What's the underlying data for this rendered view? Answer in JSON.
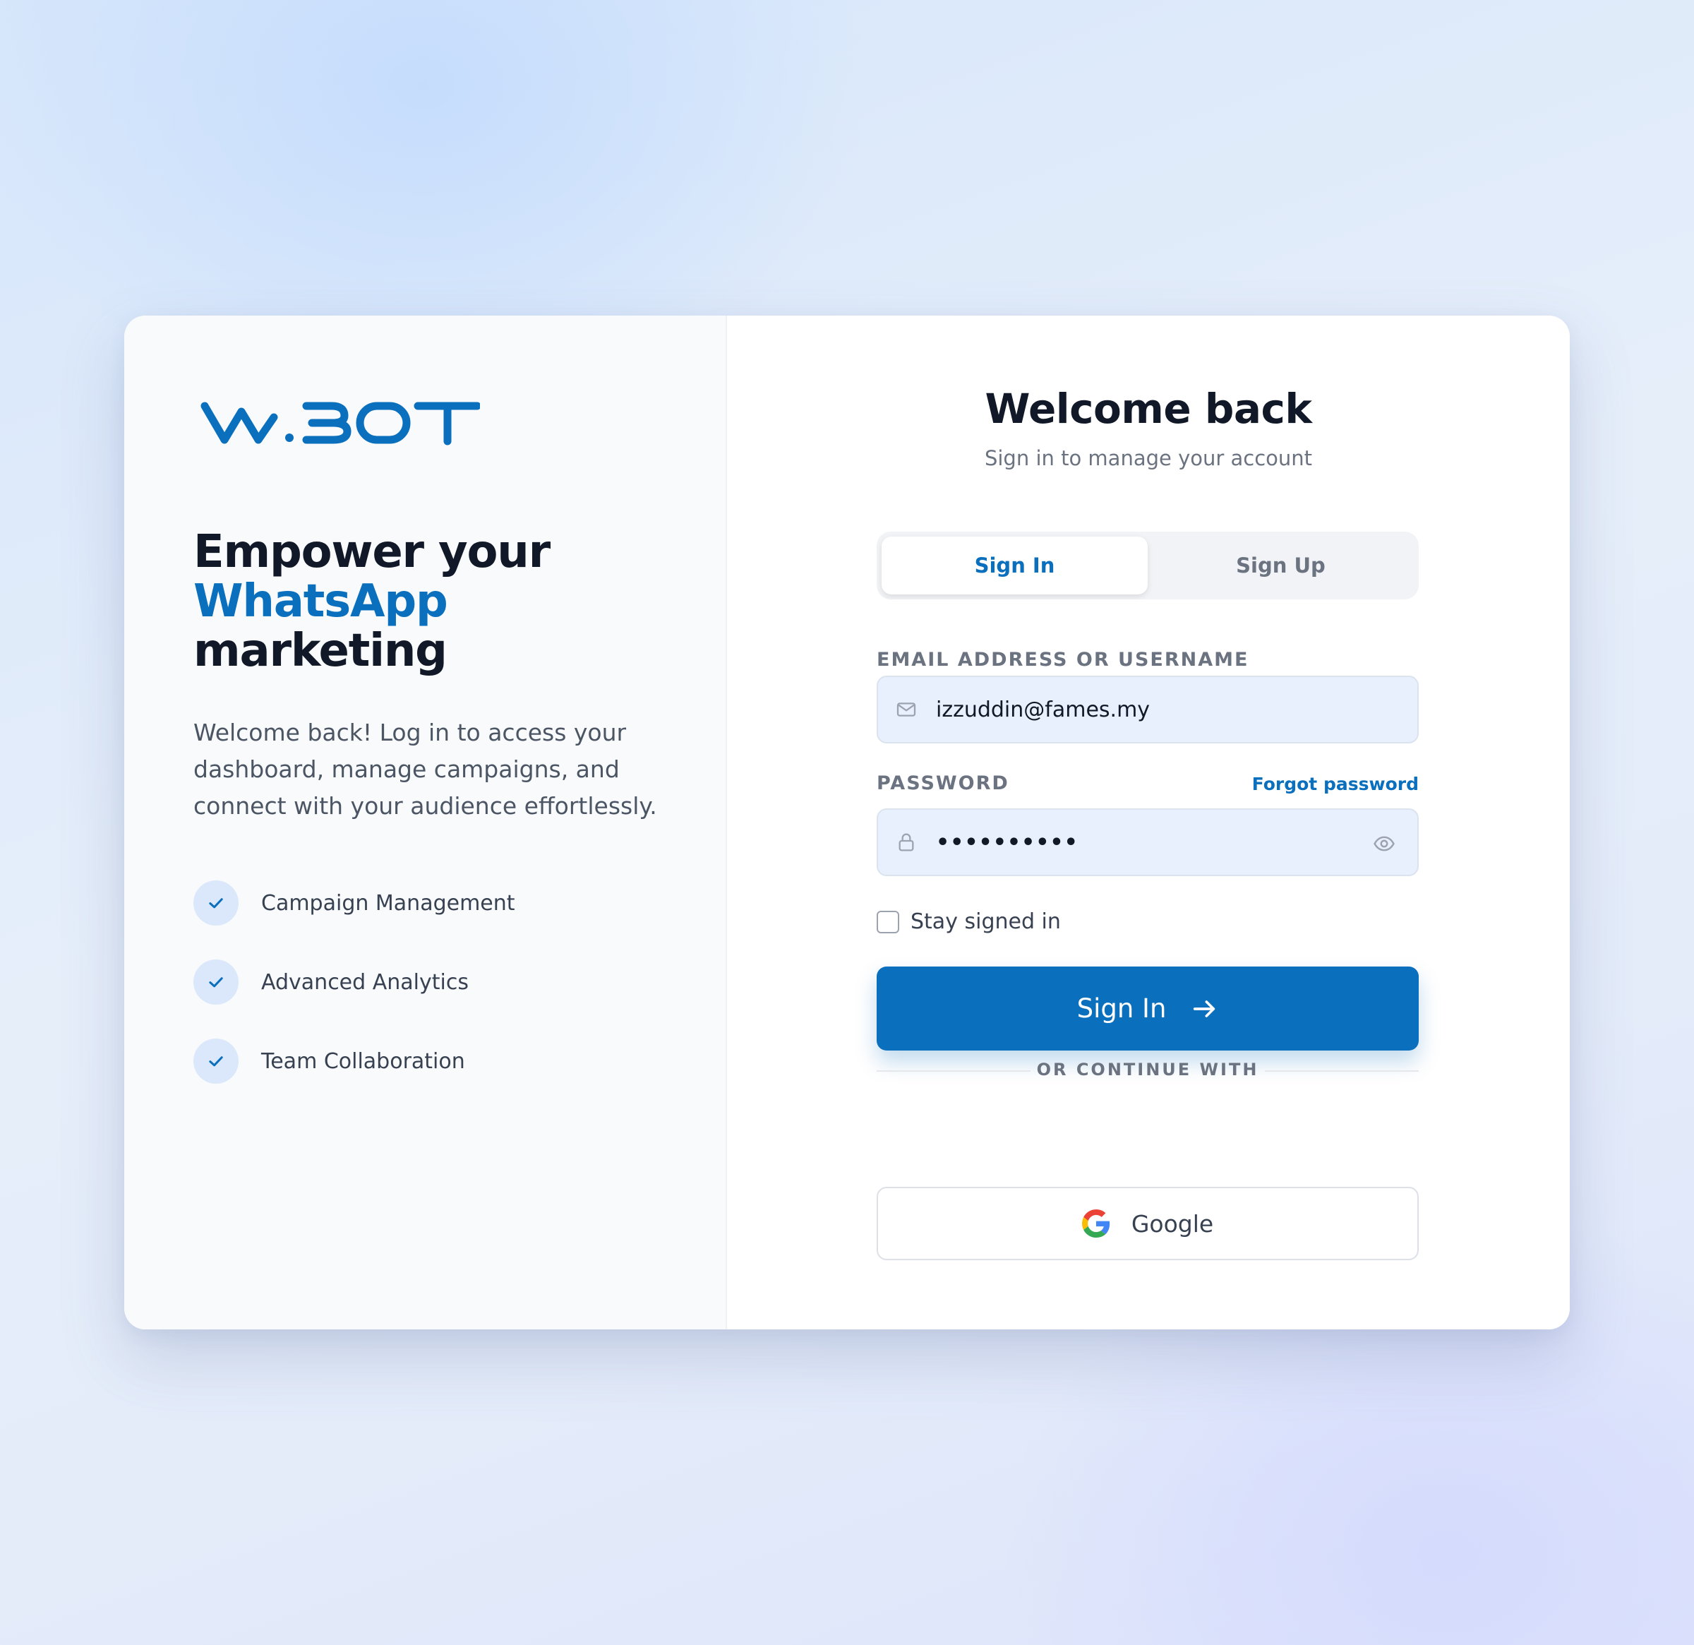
{
  "brand": {
    "logo_text": "WABOT",
    "accent_color": "#0a6fbd"
  },
  "hero": {
    "headline_line1": "Empower your",
    "headline_line2": "WhatsApp",
    "headline_line3": "marketing",
    "description": "Welcome back! Log in to access your dashboard, manage campaigns, and connect with your audience effortlessly.",
    "features": [
      {
        "icon": "check-icon",
        "label": "Campaign Management"
      },
      {
        "icon": "check-icon",
        "label": "Advanced Analytics"
      },
      {
        "icon": "check-icon",
        "label": "Team Collaboration"
      }
    ]
  },
  "form": {
    "title": "Welcome back",
    "subtitle": "Sign in to manage your account",
    "tabs": [
      {
        "label": "Sign In",
        "active": true
      },
      {
        "label": "Sign Up",
        "active": false
      }
    ],
    "email": {
      "label": "EMAIL ADDRESS OR USERNAME",
      "value": "izzuddin@fames.my",
      "icon": "mail-icon"
    },
    "password": {
      "label": "PASSWORD",
      "forgot_label": "Forgot password",
      "masked_value": "••••••••••",
      "icon": "lock-icon",
      "toggle_icon": "eye-icon"
    },
    "stay_signed_in": {
      "label": "Stay signed in",
      "checked": false
    },
    "submit_label": "Sign In",
    "divider_text": "OR CONTINUE WITH",
    "google_label": "Google"
  }
}
